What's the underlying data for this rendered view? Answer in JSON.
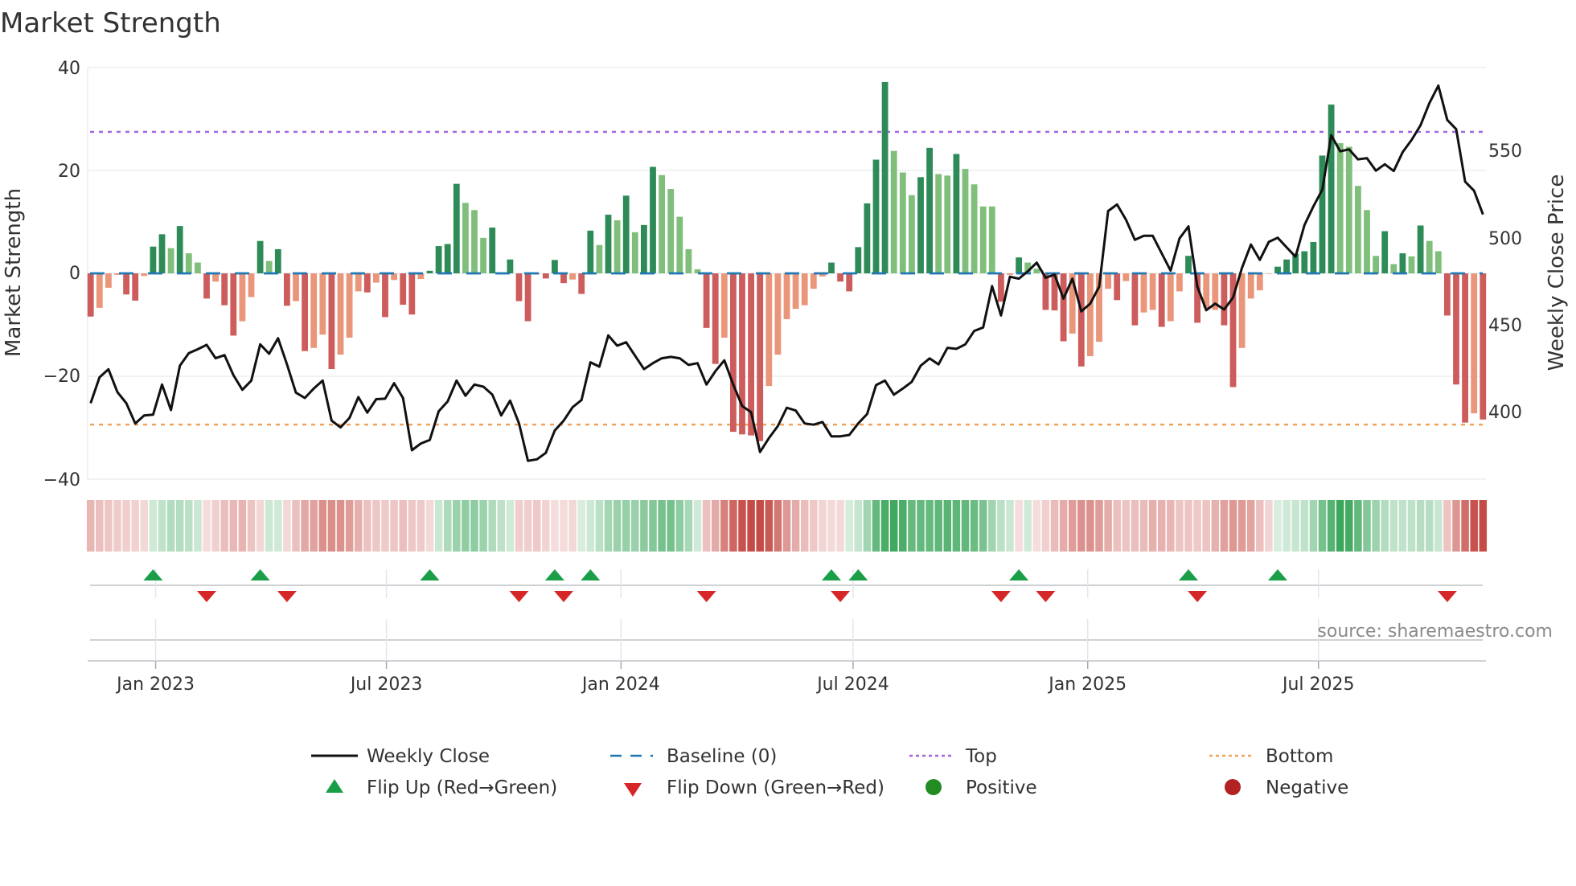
{
  "title": "Market Strength",
  "source": "source: sharemaestro.com",
  "colors": {
    "strong_green": "#2e8b57",
    "weak_green": "#7fbf7b",
    "strong_red": "#cd5c5c",
    "weak_red": "#e9967a",
    "baseline": "#1f77b4",
    "top": "#a066e0",
    "bottom": "#f0a35e",
    "close": "#111111",
    "flip_up": "#1a9e48",
    "flip_down": "#d62728",
    "positive": "#228b22",
    "negative": "#b22222"
  },
  "chart_data": {
    "type": "bar",
    "title": "Market Strength",
    "ylabel": "Market Strength",
    "y2label": "Weekly Close Price",
    "ylim": [
      -40,
      40
    ],
    "y2lim": [
      361.2,
      597.5
    ],
    "yticks": [
      "40",
      "20",
      "0",
      "−20",
      "−40"
    ],
    "ytick_values": [
      40,
      20,
      0,
      -20,
      -40
    ],
    "y2ticks": [
      "550",
      "500",
      "450",
      "400"
    ],
    "y2tick_values": [
      550,
      500,
      450,
      400
    ],
    "x_start": "2022-11-11",
    "x_interval_days": 7,
    "xticks": [
      {
        "label": "Jan 2023",
        "date": "2023-01-01"
      },
      {
        "label": "Jul 2023",
        "date": "2023-07-01"
      },
      {
        "label": "Jan 2024",
        "date": "2024-01-01"
      },
      {
        "label": "Jul 2024",
        "date": "2024-07-01"
      },
      {
        "label": "Jan 2025",
        "date": "2025-01-01"
      },
      {
        "label": "Jul 2025",
        "date": "2025-07-01"
      }
    ],
    "grid": true,
    "top": 27.5,
    "bottom": -29.4,
    "baseline": 0,
    "strength": [
      -8.4,
      -6.7,
      -2.8,
      -0.3,
      -4.1,
      -5.3,
      -0.5,
      5.2,
      7.6,
      4.9,
      9.2,
      3.9,
      2.1,
      -4.9,
      -1.6,
      -6.2,
      -12.1,
      -9.3,
      -4.6,
      6.3,
      2.4,
      4.7,
      -6.3,
      -5.4,
      -15.1,
      -14.5,
      -11.9,
      -18.6,
      -15.8,
      -12.5,
      -3.5,
      -3.7,
      -1.8,
      -8.5,
      -1.3,
      -6.1,
      -8.0,
      -1.1,
      0.5,
      5.3,
      5.7,
      17.4,
      13.7,
      12.3,
      6.9,
      8.9,
      0.0,
      2.7,
      -5.4,
      -9.3,
      -0.2,
      -1.0,
      2.6,
      -1.9,
      -1.2,
      -4.0,
      8.3,
      5.5,
      11.4,
      10.3,
      15.1,
      8.0,
      9.4,
      20.7,
      19.1,
      16.4,
      11.0,
      4.7,
      0.8,
      -10.6,
      -17.6,
      -12.5,
      -30.8,
      -31.3,
      -31.5,
      -32.6,
      -21.9,
      -15.8,
      -8.9,
      -6.9,
      -6.2,
      -3.0,
      -0.6,
      2.1,
      -1.6,
      -3.5,
      5.1,
      13.6,
      22.1,
      37.2,
      23.8,
      19.6,
      15.2,
      18.7,
      24.4,
      19.3,
      19.0,
      23.2,
      20.3,
      17.3,
      13.0,
      13.0,
      -5.5,
      -0.3,
      3.1,
      2.1,
      0.9,
      -7.1,
      -7.2,
      -13.2,
      -11.7,
      -18.1,
      -16.1,
      -13.3,
      -3.0,
      -5.2,
      -1.5,
      -10.1,
      -7.6,
      -7.1,
      -10.4,
      -9.3,
      -3.5,
      3.4,
      -9.6,
      -6.7,
      -7.1,
      -10.1,
      -22.1,
      -14.5,
      -4.9,
      -3.3,
      -0.1,
      1.3,
      2.7,
      3.8,
      4.3,
      6.1,
      22.9,
      32.8,
      25.3,
      24.6,
      17.0,
      12.3,
      3.4,
      8.2,
      1.8,
      3.9,
      3.3,
      9.3,
      6.3,
      4.3,
      -8.2,
      -21.6,
      -29.0,
      -27.2,
      -28.4
    ],
    "shade": [
      "D",
      "L",
      "L",
      "L",
      "D",
      "D",
      "L",
      "D",
      "D",
      "L",
      "D",
      "L",
      "L",
      "D",
      "L",
      "D",
      "D",
      "L",
      "L",
      "D",
      "L",
      "D",
      "D",
      "L",
      "D",
      "L",
      "L",
      "D",
      "L",
      "L",
      "L",
      "D",
      "L",
      "D",
      "L",
      "D",
      "D",
      "L",
      "D",
      "D",
      "D",
      "D",
      "L",
      "L",
      "L",
      "D",
      "L",
      "D",
      "D",
      "D",
      "L",
      "D",
      "D",
      "D",
      "L",
      "D",
      "D",
      "L",
      "D",
      "L",
      "D",
      "L",
      "D",
      "D",
      "L",
      "L",
      "L",
      "L",
      "L",
      "D",
      "D",
      "L",
      "D",
      "D",
      "D",
      "D",
      "L",
      "L",
      "L",
      "L",
      "L",
      "L",
      "L",
      "D",
      "D",
      "D",
      "D",
      "D",
      "D",
      "D",
      "L",
      "L",
      "L",
      "D",
      "D",
      "L",
      "L",
      "D",
      "L",
      "L",
      "L",
      "L",
      "D",
      "L",
      "D",
      "L",
      "L",
      "D",
      "D",
      "D",
      "L",
      "D",
      "L",
      "L",
      "L",
      "D",
      "L",
      "D",
      "L",
      "L",
      "D",
      "L",
      "L",
      "D",
      "D",
      "L",
      "L",
      "D",
      "D",
      "L",
      "L",
      "L",
      "L",
      "D",
      "D",
      "D",
      "D",
      "D",
      "D",
      "D",
      "L",
      "L",
      "L",
      "L",
      "L",
      "D",
      "L",
      "D",
      "L",
      "D",
      "L",
      "L",
      "D",
      "D",
      "D",
      "L",
      "D"
    ],
    "weekly_close": [
      404.8,
      419.7,
      424.3,
      411.2,
      404.8,
      393.2,
      397.8,
      398.2,
      415.5,
      400.9,
      426.3,
      433.5,
      435.8,
      438.3,
      430.6,
      432.4,
      420.9,
      412.5,
      417.8,
      438.6,
      433.2,
      442.1,
      427.1,
      410.9,
      407.8,
      413.2,
      417.8,
      394.8,
      390.9,
      396.3,
      408.3,
      399.4,
      407.1,
      407.4,
      416.3,
      407.8,
      377.8,
      381.7,
      383.7,
      400.2,
      405.8,
      417.8,
      409.1,
      415.5,
      414.3,
      409.8,
      397.8,
      406.3,
      393.2,
      371.7,
      372.6,
      376.3,
      389.1,
      394.8,
      402.5,
      406.6,
      428.3,
      425.8,
      443.7,
      437.8,
      439.8,
      432.1,
      424.4,
      427.8,
      430.6,
      431.4,
      430.6,
      426.8,
      427.8,
      415.5,
      423.2,
      429.4,
      415.5,
      403.2,
      399.7,
      376.8,
      384.8,
      391.7,
      402.2,
      400.6,
      393.2,
      392.5,
      394.0,
      385.8,
      385.8,
      386.6,
      393.2,
      398.6,
      415.2,
      417.8,
      409.7,
      413.2,
      417.1,
      426.3,
      430.5,
      427.1,
      436.6,
      436.0,
      438.6,
      446.3,
      448.3,
      472.0,
      455.2,
      477.4,
      476.3,
      480.5,
      485.5,
      476.8,
      478.6,
      464.8,
      476.3,
      457.5,
      462.0,
      471.7,
      515.1,
      518.9,
      510.2,
      498.6,
      500.9,
      500.9,
      490.9,
      480.9,
      499.4,
      506.3,
      471.7,
      458.2,
      462.0,
      458.6,
      465.5,
      482.5,
      495.9,
      487.1,
      497.4,
      499.8,
      494.3,
      488.9,
      507.1,
      517.8,
      527.4,
      558.6,
      549.4,
      550.5,
      544.8,
      545.5,
      538.3,
      542.0,
      538.1,
      548.9,
      555.9,
      564.3,
      577.1,
      587.1,
      567.4,
      562.1,
      532.0,
      526.8,
      513.2
    ],
    "flip_up": [
      "2022-12-30",
      "2023-03-24",
      "2023-08-04",
      "2023-11-10",
      "2023-12-08",
      "2024-06-14",
      "2024-07-05",
      "2024-11-08",
      "2025-03-21",
      "2025-05-30"
    ],
    "flip_down": [
      "2023-02-10",
      "2023-04-14",
      "2023-10-13",
      "2023-11-17",
      "2024-03-08",
      "2024-06-21",
      "2024-10-25",
      "2024-11-29",
      "2025-03-28",
      "2025-10-10"
    ],
    "legend": {
      "placement": "bottom",
      "items": [
        {
          "label": "Weekly Close",
          "symbol": "line"
        },
        {
          "label": "Baseline (0)",
          "symbol": "dash"
        },
        {
          "label": "Top",
          "symbol": "dot"
        },
        {
          "label": "Bottom",
          "symbol": "dot"
        },
        {
          "label": "Flip Up (Red→Green)",
          "symbol": "triangle-up"
        },
        {
          "label": "Flip Down (Green→Red)",
          "symbol": "triangle-down"
        },
        {
          "label": "Positive",
          "symbol": "circle"
        },
        {
          "label": "Negative",
          "symbol": "circle"
        }
      ]
    }
  }
}
